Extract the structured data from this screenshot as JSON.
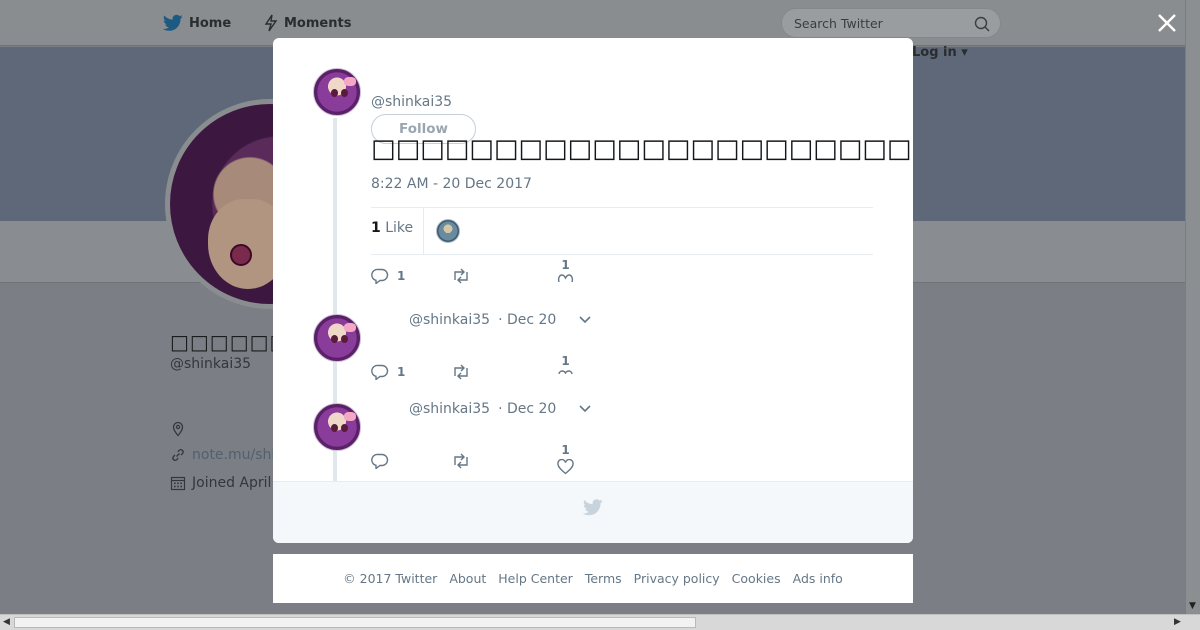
{
  "nav": {
    "home": "Home",
    "moments": "Moments",
    "search_placeholder": "Search Twitter",
    "login": "Log in"
  },
  "profile": {
    "name": "□□□□□□□□",
    "handle": "@shinkai35",
    "link": "note.mu/shi",
    "joined": "Joined April"
  },
  "tweet": {
    "handle": "@shinkai35",
    "follow": "Follow",
    "text": "□□□□□□□□□□□□□□□□□□□□□□□□□□□□□□□□□□□□□□□□□□□□□□□□□□",
    "time": "8:22 AM - 20 Dec 2017",
    "like_count": "1",
    "like_label": "Like",
    "reply_count": "1",
    "fav_count": "1"
  },
  "replies": [
    {
      "handle": "@shinkai35",
      "date": "· Dec 20",
      "reply_count": "1",
      "fav_count": "1"
    },
    {
      "handle": "@shinkai35",
      "date": "· Dec 20",
      "reply_count": "",
      "fav_count": "1"
    }
  ],
  "footer": {
    "copyright": "© 2017 Twitter",
    "about": "About",
    "help": "Help Center",
    "terms": "Terms",
    "privacy": "Privacy policy",
    "cookies": "Cookies",
    "ads": "Ads info"
  },
  "colors": {
    "brand": "#1da1f2",
    "overlay": "#7b7f85",
    "secondary_text": "#657786"
  },
  "icons": {
    "brand": "twitter-bird-icon",
    "moments": "lightning-icon",
    "search": "search-icon",
    "close": "close-icon",
    "reply": "reply-icon",
    "retweet": "retweet-icon",
    "like": "heart-icon",
    "more": "chevron-down-icon",
    "location": "location-icon",
    "link": "link-icon",
    "calendar": "calendar-icon"
  }
}
